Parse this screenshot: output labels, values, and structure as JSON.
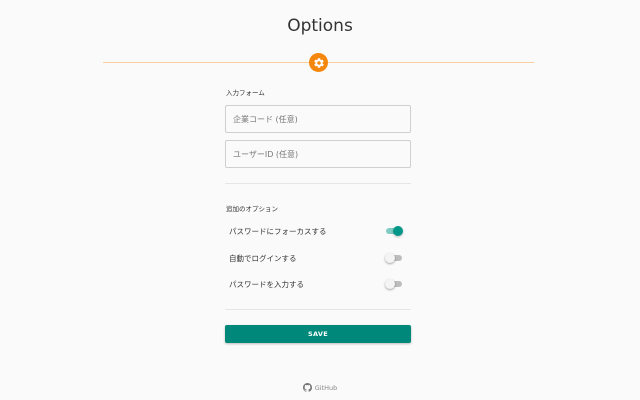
{
  "page": {
    "title": "Options"
  },
  "colors": {
    "accent": "#f5870d",
    "primary": "#009688",
    "button": "#00897b"
  },
  "header_icon": "gear-icon",
  "input_form": {
    "section_label": "入力フォーム",
    "fields": [
      {
        "placeholder": "企業コード (任意)",
        "value": ""
      },
      {
        "placeholder": "ユーザーID (任意)",
        "value": ""
      }
    ]
  },
  "options": {
    "section_label": "追加のオプション",
    "items": [
      {
        "label": "パスワードにフォーカスする",
        "enabled": true
      },
      {
        "label": "自動でログインする",
        "enabled": false
      },
      {
        "label": "パスワードを入力する",
        "enabled": false
      }
    ]
  },
  "save_button": {
    "label": "SAVE"
  },
  "footer": {
    "icon": "github-icon",
    "link_label": "GitHub"
  }
}
